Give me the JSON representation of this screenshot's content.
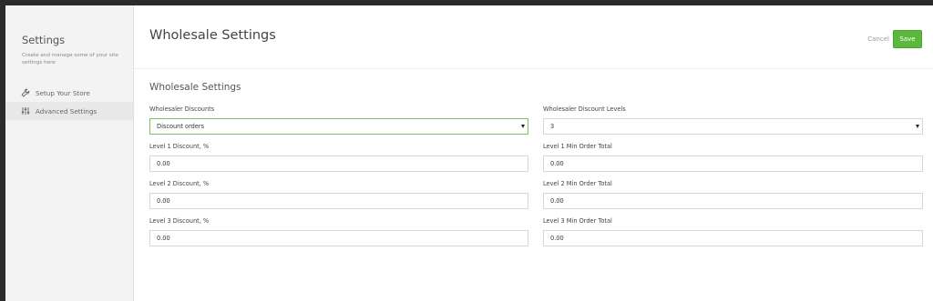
{
  "sidebar": {
    "title": "Settings",
    "description": "Create and manage some of your site settings here",
    "items": [
      {
        "label": "Setup Your Store",
        "icon": "wrench-icon",
        "active": false
      },
      {
        "label": "Advanced Settings",
        "icon": "sliders-icon",
        "active": true
      }
    ]
  },
  "header": {
    "title": "Wholesale Settings",
    "cancel_label": "Cancel",
    "save_label": "Save",
    "save_color": "#5cb83c"
  },
  "form": {
    "section_title": "Wholesale Settings",
    "discounts": {
      "label": "Wholesaler Discounts",
      "value": "Discount orders"
    },
    "levels": {
      "label": "Wholesaler Discount Levels",
      "value": "3"
    },
    "level1_discount": {
      "label": "Level 1 Discount, %",
      "value": "0.00"
    },
    "level1_min": {
      "label": "Level 1 Min Order Total",
      "value": "0.00"
    },
    "level2_discount": {
      "label": "Level 2 Discount, %",
      "value": "0.00"
    },
    "level2_min": {
      "label": "Level 2 Min Order Total",
      "value": "0.00"
    },
    "level3_discount": {
      "label": "Level 3 Discount, %",
      "value": "0.00"
    },
    "level3_min": {
      "label": "Level 3 Min Order Total",
      "value": "0.00"
    }
  }
}
